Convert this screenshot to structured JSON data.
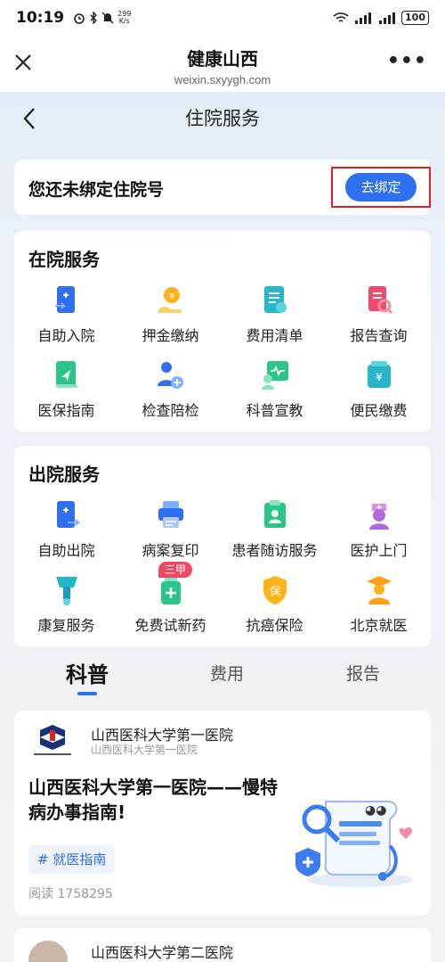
{
  "status_bar": {
    "time": "10:19",
    "speed_value": "299",
    "speed_unit": "K/s",
    "battery": "100"
  },
  "miniprogram": {
    "title": "健康山西",
    "url": "weixin.sxyygh.com",
    "more_label": "•••"
  },
  "nav": {
    "title": "住院服务"
  },
  "bind": {
    "text": "您还未绑定住院号",
    "button_label": "去绑定"
  },
  "inpatient": {
    "heading": "在院服务",
    "items": [
      {
        "label": "自助入院",
        "icon": "self-admission-icon"
      },
      {
        "label": "押金缴纳",
        "icon": "deposit-icon"
      },
      {
        "label": "费用清单",
        "icon": "expense-list-icon"
      },
      {
        "label": "报告查询",
        "icon": "report-query-icon"
      },
      {
        "label": "医保指南",
        "icon": "insurance-guide-icon"
      },
      {
        "label": "检查陪检",
        "icon": "exam-escort-icon"
      },
      {
        "label": "科普宣教",
        "icon": "health-education-icon"
      },
      {
        "label": "便民缴费",
        "icon": "convenient-payment-icon"
      }
    ]
  },
  "discharge": {
    "heading": "出院服务",
    "items": [
      {
        "label": "自助出院",
        "icon": "self-discharge-icon"
      },
      {
        "label": "病案复印",
        "icon": "record-copy-icon"
      },
      {
        "label": "患者随访服务",
        "icon": "follow-up-icon"
      },
      {
        "label": "医护上门",
        "icon": "home-nurse-icon"
      },
      {
        "label": "康复服务",
        "icon": "rehab-icon"
      },
      {
        "label": "免费试新药",
        "icon": "free-drug-trial-icon",
        "badge": "三甲"
      },
      {
        "label": "抗癌保险",
        "icon": "cancer-insurance-icon"
      },
      {
        "label": "北京就医",
        "icon": "beijing-doctor-icon"
      }
    ]
  },
  "tabs": [
    "科普",
    "费用",
    "报告"
  ],
  "article": {
    "org": "山西医科大学第一医院",
    "org_sub": "山西医科大学第一医院",
    "title": "山西医科大学第一医院——慢特病办事指南!",
    "tag": "# 就医指南",
    "reads": "阅读 1758295"
  },
  "article2": {
    "org": "山西医科大学第二医院"
  },
  "colors": {
    "accent": "#2f6ff0",
    "highlight_border": "#e02020",
    "badge": "#f04864"
  }
}
